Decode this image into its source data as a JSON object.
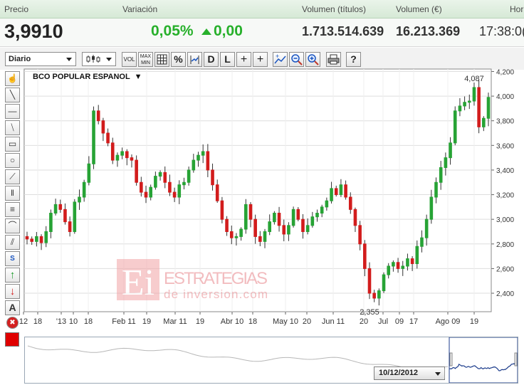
{
  "header": {
    "labels": {
      "price": "Precio",
      "variation": "Variación",
      "volume_titles": "Volumen (títulos)",
      "volume_eur": "Volumen (€)",
      "time": "Hor"
    },
    "price": "3,9910",
    "variation_pct": "0,05%",
    "change": "0,00",
    "volume_titles": "1.713.514.639",
    "volume_eur": "16.213.369",
    "time": "17:38:0("
  },
  "toolbar": {
    "period": "Diario",
    "buttons": [
      {
        "name": "chart-type-select",
        "label": ""
      },
      {
        "name": "vol-button",
        "label": "VOL"
      },
      {
        "name": "max-min-button",
        "label": "MAX MIN"
      },
      {
        "name": "grid-button",
        "label": ""
      },
      {
        "name": "percent-button",
        "label": "%"
      },
      {
        "name": "compare-button",
        "label": ""
      },
      {
        "name": "d-button",
        "label": "D"
      },
      {
        "name": "l-button",
        "label": "L"
      },
      {
        "name": "crosshair-button",
        "label": "+"
      },
      {
        "name": "crosshair-l-button",
        "label": "+"
      },
      {
        "name": "zoom-select-button",
        "label": ""
      },
      {
        "name": "zoom-out-button",
        "label": ""
      },
      {
        "name": "zoom-in-button",
        "label": ""
      },
      {
        "name": "print-button",
        "label": ""
      },
      {
        "name": "help-button",
        "label": "?"
      }
    ]
  },
  "tools": [
    {
      "name": "hand-tool-icon",
      "glyph": "☝"
    },
    {
      "name": "line-tool-icon",
      "glyph": "╲"
    },
    {
      "name": "hline-tool-icon",
      "glyph": "—"
    },
    {
      "name": "channel-tool-icon",
      "glyph": "⧹"
    },
    {
      "name": "rectangle-tool-icon",
      "glyph": "▭"
    },
    {
      "name": "circle-tool-icon",
      "glyph": "○"
    },
    {
      "name": "fan-tool-icon",
      "glyph": "⟋"
    },
    {
      "name": "fibonacci-vertical-tool-icon",
      "glyph": "‖"
    },
    {
      "name": "fibonacci-horizontal-tool-icon",
      "glyph": "≡"
    },
    {
      "name": "arc-tool-icon",
      "glyph": "⌒"
    },
    {
      "name": "parallel-tool-icon",
      "glyph": "⫽"
    },
    {
      "name": "speed-lines-tool-icon",
      "glyph": "S"
    },
    {
      "name": "buy-arrow-icon",
      "glyph": "↑"
    },
    {
      "name": "sell-arrow-icon",
      "glyph": "↓"
    },
    {
      "name": "text-tool-icon",
      "glyph": "A"
    },
    {
      "name": "delete-tool-icon",
      "glyph": "✖"
    }
  ],
  "colors": {
    "up": "#27a335",
    "down": "#d21c1c",
    "accent_green": "#27b02b",
    "logo": "#f2a3a6"
  },
  "watermark": {
    "logo_letters": "Ei",
    "line1": "ESTRATEGIAS",
    "line2": "de inversion.com"
  },
  "navigator": {
    "date": "10/12/2012"
  },
  "chart_data": {
    "type": "candlestick",
    "title": "BCO POPULAR ESPANOL",
    "ylim": [
      2.25,
      4.22
    ],
    "y_ticks": [
      "4,200",
      "4,000",
      "3,800",
      "3,600",
      "3,400",
      "3,200",
      "3,000",
      "2,800",
      "2,600",
      "2,400"
    ],
    "x_tick_labels": [
      "12",
      "18",
      "'13",
      "10",
      "18",
      "Feb 11",
      "19",
      "Mar 11",
      "19",
      "Abr 10",
      "18",
      "May 10",
      "20",
      "Jun 11",
      "20",
      "Jul",
      "09",
      "17",
      "Ago 09",
      "19"
    ],
    "annotations": [
      {
        "text": "4,087",
        "value": 4.087,
        "index": 94
      },
      {
        "text": "2,355",
        "value": 2.355,
        "index": 72
      }
    ],
    "close_values": [
      2.84,
      2.82,
      2.86,
      2.81,
      2.9,
      3.05,
      3.12,
      3.08,
      2.98,
      2.9,
      3.14,
      3.18,
      3.3,
      3.45,
      3.88,
      3.8,
      3.7,
      3.62,
      3.48,
      3.52,
      3.55,
      3.5,
      3.48,
      3.3,
      3.22,
      3.18,
      3.26,
      3.35,
      3.38,
      3.3,
      3.22,
      3.18,
      3.28,
      3.3,
      3.4,
      3.48,
      3.52,
      3.55,
      3.4,
      3.28,
      3.15,
      3.0,
      2.9,
      2.85,
      2.86,
      2.92,
      3.12,
      3.0,
      2.86,
      2.82,
      2.9,
      2.98,
      3.05,
      2.95,
      2.88,
      2.95,
      3.08,
      3.0,
      2.9,
      2.95,
      3.02,
      3.05,
      3.1,
      3.15,
      3.25,
      3.2,
      3.28,
      3.18,
      3.08,
      2.95,
      2.8,
      2.6,
      2.4,
      2.36,
      2.42,
      2.55,
      2.62,
      2.65,
      2.6,
      2.62,
      2.68,
      2.64,
      2.78,
      2.85,
      3.0,
      3.18,
      3.3,
      3.42,
      3.5,
      3.62,
      3.88,
      3.92,
      3.95,
      3.96,
      4.07,
      3.75,
      3.82,
      3.99
    ]
  }
}
